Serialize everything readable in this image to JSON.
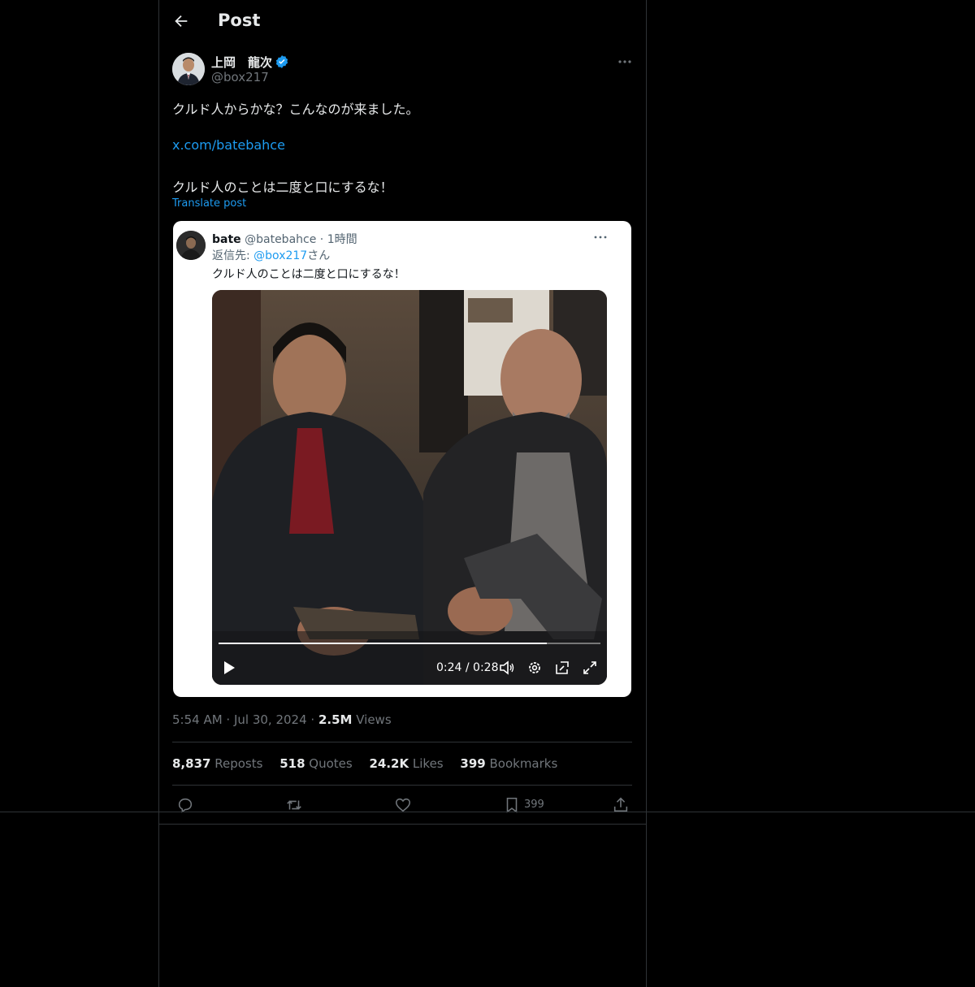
{
  "header": {
    "title": "Post"
  },
  "author": {
    "name": "上岡　龍次",
    "handle": "@box217"
  },
  "post": {
    "line1": "クルド人からかな？こんなのが来ました。",
    "link": "x.com/batebahce",
    "line2": "クルド人のことは二度と口にするな！",
    "translate": "Translate post"
  },
  "quoted": {
    "name": "bate",
    "handle": "@batebahce",
    "sep": " · ",
    "time": "1時間",
    "reply_prefix": "返信先: ",
    "reply_handle": "@box217",
    "reply_suffix": "さん",
    "text": "クルド人のことは二度と口にするな！",
    "video": {
      "time": "0:24 / 0:28",
      "progress": 0.86
    }
  },
  "meta": {
    "time": "5:54 AM",
    "dot": " · ",
    "date": "Jul 30, 2024",
    "views_count": "2.5M",
    "views_label": " Views"
  },
  "stats": [
    {
      "count": "8,837",
      "label": " Reposts"
    },
    {
      "count": "518",
      "label": " Quotes"
    },
    {
      "count": "24.2K",
      "label": " Likes"
    },
    {
      "count": "399",
      "label": " Bookmarks"
    }
  ],
  "actions": {
    "bookmark_count": "399"
  },
  "icons": [
    "back-arrow-icon",
    "verified-badge-icon",
    "more-icon",
    "play-icon",
    "volume-icon",
    "settings-icon",
    "pip-icon",
    "fullscreen-icon",
    "reply-icon",
    "repost-icon",
    "like-icon",
    "bookmark-icon",
    "share-icon"
  ],
  "colors": {
    "accent": "#1d9bf0",
    "background": "#000000",
    "muted": "#71767b",
    "border": "#2f3336"
  }
}
